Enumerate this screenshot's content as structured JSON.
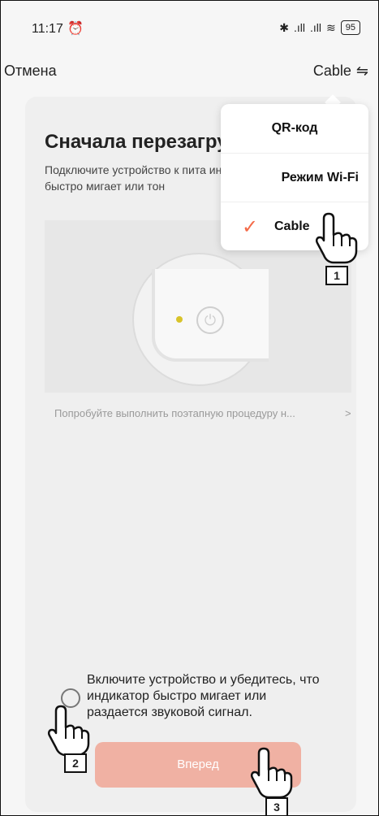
{
  "status_bar": {
    "time": "11:17",
    "alarm_icon": "⏰",
    "bluetooth_icon": "✱",
    "signal1": ".ıll",
    "signal2": ".ıll",
    "wifi_icon": "≋",
    "battery": "95"
  },
  "header": {
    "cancel": "Отмена",
    "mode_label": "Cable",
    "swap_icon": "⇋"
  },
  "card": {
    "title": "Сначала перезагруз",
    "description": "Подключите устройство к пита индикатор быстро мигает или тон",
    "troubleshoot": "Попробуйте выполнить поэтапную процедуру н...",
    "troubleshoot_arrow": ">",
    "confirm_text": "Включите устройство и убедитесь, что индикатор быстро мигает или раздается звуковой сигнал.",
    "next_button": "Вперед"
  },
  "dropdown": {
    "items": [
      {
        "label": "QR-код",
        "selected": false
      },
      {
        "label": "Режим Wi-Fi",
        "selected": false
      },
      {
        "label": "Cable",
        "selected": true
      }
    ],
    "check_icon": "✓",
    "accent_color": "#f46a48"
  },
  "annotations": {
    "labels": [
      "1",
      "2",
      "3"
    ]
  }
}
